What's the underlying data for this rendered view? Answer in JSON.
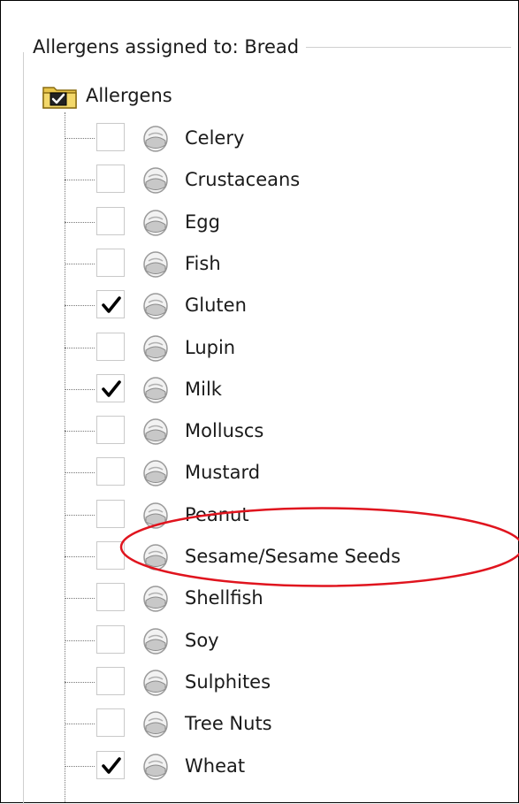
{
  "group": {
    "title": "Allergens assigned to: Bread"
  },
  "tree": {
    "root_label": "Allergens",
    "root_icon": "folder-check-icon",
    "item_icon": "allergen-node-icon",
    "items": [
      {
        "label": "Celery",
        "checked": false
      },
      {
        "label": "Crustaceans",
        "checked": false
      },
      {
        "label": "Egg",
        "checked": false
      },
      {
        "label": "Fish",
        "checked": false
      },
      {
        "label": "Gluten",
        "checked": true
      },
      {
        "label": "Lupin",
        "checked": false
      },
      {
        "label": "Milk",
        "checked": true
      },
      {
        "label": "Molluscs",
        "checked": false
      },
      {
        "label": "Mustard",
        "checked": false
      },
      {
        "label": "Peanut",
        "checked": false
      },
      {
        "label": "Sesame/Sesame Seeds",
        "checked": false
      },
      {
        "label": "Shellfish",
        "checked": false
      },
      {
        "label": "Soy",
        "checked": false
      },
      {
        "label": "Sulphites",
        "checked": false
      },
      {
        "label": "Tree Nuts",
        "checked": false
      },
      {
        "label": "Wheat",
        "checked": true
      }
    ]
  },
  "annotation": {
    "highlight_color": "#e0141e",
    "highlighted_item": "Sesame/Sesame Seeds"
  }
}
